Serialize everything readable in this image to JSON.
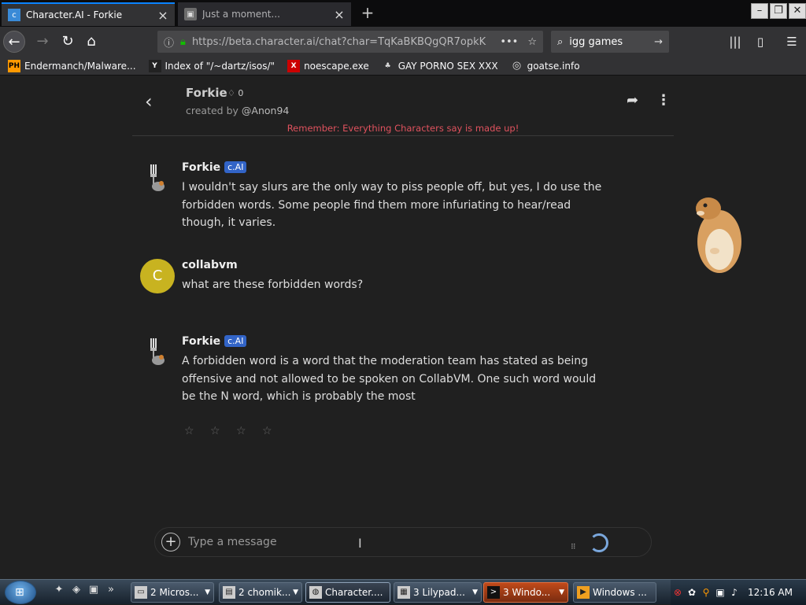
{
  "browser": {
    "tabs": [
      {
        "title": "Character.AI - Forkie",
        "active": true
      },
      {
        "title": "Just a moment...",
        "active": false
      }
    ],
    "url": "https://beta.character.ai/chat?char=TqKaBKBQgQR7opkK",
    "search_value": "igg games",
    "bookmarks": [
      {
        "icon": "PH",
        "label": "Endermanch/Malware..."
      },
      {
        "icon": "Y",
        "label": "Index of \"/~dartz/isos/\""
      },
      {
        "icon": "X",
        "label": "noescape.exe"
      },
      {
        "icon": "♣",
        "label": "GAY PORNO SEX XXX"
      },
      {
        "icon": "globe-icon",
        "label": "goatse.info"
      }
    ],
    "colors": {
      "accent": "#0a84ff",
      "toolbar": "#323234",
      "lock": "#12bc00"
    }
  },
  "chat": {
    "character_name": "Forkie",
    "likes": "0",
    "created_by_prefix": "created by",
    "creator": "@Anon94",
    "warning": "Remember: Everything Characters say is made up!",
    "badge": "c.AI",
    "messages": [
      {
        "sender": "Forkie",
        "is_bot": true,
        "text": "I wouldn't say slurs are the only way to piss people off, but yes, I do use the forbidden words. Some people find them more infuriating to hear/read though, it varies."
      },
      {
        "sender": "collabvm",
        "is_bot": false,
        "avatar_letter": "C",
        "text": "what are these forbidden words?"
      },
      {
        "sender": "Forkie",
        "is_bot": true,
        "text": "A forbidden word is a word that the moderation team has stated as being offensive and not allowed to be spoken on CollabVM. One such word would be the N word, which is probably the most"
      }
    ],
    "rating_stars": "☆ ☆ ☆ ☆",
    "input_placeholder": "Type a message",
    "colors": {
      "warning": "#e0525e",
      "badge": "#3264c7",
      "user_avatar": "#c8b320"
    }
  },
  "taskbar": {
    "items": [
      {
        "label": "2 Micros...",
        "icon": "window-icon"
      },
      {
        "label": "2 chomik...",
        "icon": "folder-icon"
      },
      {
        "label": "Character....",
        "icon": "firefox-icon"
      },
      {
        "label": "3 Lilypad...",
        "icon": "notepad-icon"
      },
      {
        "label": "3 Windo...",
        "icon": "cmd-icon"
      },
      {
        "label": "Windows ...",
        "icon": "media-icon"
      }
    ],
    "clock": "12:16 AM"
  }
}
